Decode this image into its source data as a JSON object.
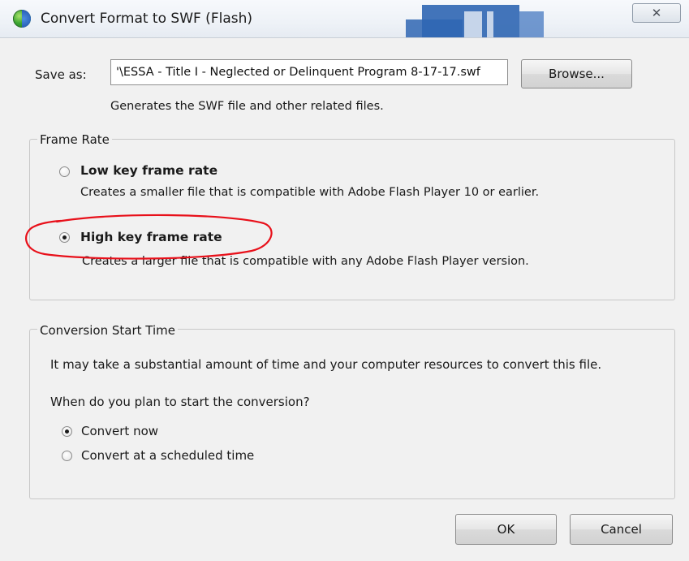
{
  "window": {
    "title": "Convert Format to SWF (Flash)",
    "close_label": "✕"
  },
  "save": {
    "label": "Save as:",
    "value": "'\\ESSA - Title I - Neglected or Delinquent Program 8-17-17.swf",
    "browse_label": "Browse...",
    "hint": "Generates the SWF file and other related files."
  },
  "frame_rate": {
    "legend": "Frame Rate",
    "options": [
      {
        "label": "Low key frame rate",
        "description": "Creates a smaller file that is compatible with Adobe Flash Player 10 or earlier.",
        "checked": false
      },
      {
        "label": "High key frame rate",
        "description": "Creates a larger file that is compatible with any Adobe Flash Player version.",
        "checked": true
      }
    ]
  },
  "conversion": {
    "legend": "Conversion Start Time",
    "note": "It may take a substantial amount of time and your computer resources to convert this file.",
    "question": "When do you plan to start the conversion?",
    "options": [
      {
        "label": "Convert now",
        "checked": true
      },
      {
        "label": "Convert at a scheduled time",
        "checked": false
      }
    ]
  },
  "footer": {
    "ok_label": "OK",
    "cancel_label": "Cancel"
  },
  "colors": {
    "annotation": "#e8101a",
    "title_deco": "#2f66b3"
  }
}
